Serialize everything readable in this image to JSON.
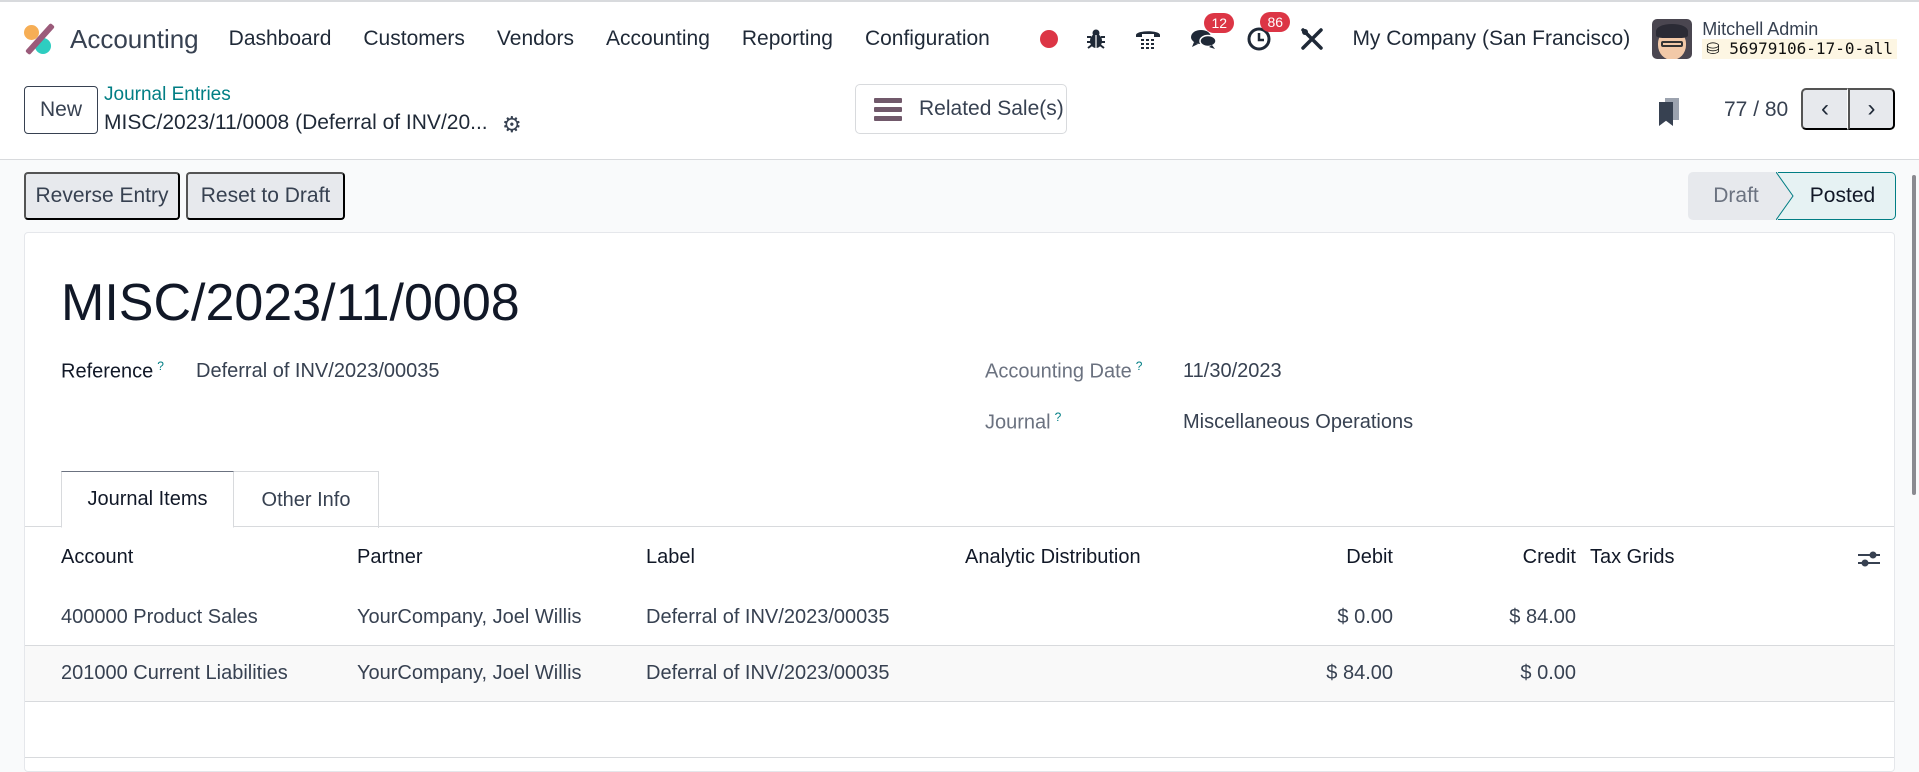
{
  "navbar": {
    "app_name": "Accounting",
    "menu": [
      "Dashboard",
      "Customers",
      "Vendors",
      "Accounting",
      "Reporting",
      "Configuration"
    ],
    "icons": {
      "record": "record-dot-icon",
      "debug": "bug-icon",
      "phone": "phone-icon",
      "messages": "chat-icon",
      "activities": "clock-icon",
      "settings": "tools-icon"
    },
    "messages_count": "12",
    "activities_count": "86",
    "company": "My Company (San Francisco)",
    "user_name": "Mitchell Admin",
    "database": "56979106-17-0-all",
    "colors": {
      "badge": "#dc3545",
      "accent": "#017e84"
    }
  },
  "control_panel": {
    "new_label": "New",
    "breadcrumb_parent": "Journal Entries",
    "breadcrumb_current": "MISC/2023/11/0008 (Deferral of INV/20...",
    "related_button": "Related Sale(s)",
    "pager_value": "77 / 80",
    "prev_symbol": "‹",
    "next_symbol": "›"
  },
  "status_bar": {
    "actions": [
      "Reverse Entry",
      "Reset to Draft"
    ],
    "states": [
      "Draft",
      "Posted"
    ],
    "current_state": "Posted"
  },
  "form": {
    "title": "MISC/2023/11/0008",
    "reference_label": "Reference",
    "reference_value": "Deferral of INV/2023/00035",
    "date_label": "Accounting Date",
    "date_value": "11/30/2023",
    "journal_label": "Journal",
    "journal_value": "Miscellaneous Operations",
    "help_mark": "?",
    "tabs": [
      "Journal Items",
      "Other Info"
    ],
    "active_tab": "Journal Items"
  },
  "table": {
    "columns": [
      "Account",
      "Partner",
      "Label",
      "Analytic Distribution",
      "Debit",
      "Credit",
      "Tax Grids"
    ],
    "rows": [
      {
        "account": "400000 Product Sales",
        "partner": "YourCompany, Joel Willis",
        "label": "Deferral of INV/2023/00035",
        "analytic": "",
        "debit": "$ 0.00",
        "credit": "$ 84.00",
        "tax_grids": ""
      },
      {
        "account": "201000 Current Liabilities",
        "partner": "YourCompany, Joel Willis",
        "label": "Deferral of INV/2023/00035",
        "analytic": "",
        "debit": "$ 84.00",
        "credit": "$ 0.00",
        "tax_grids": ""
      }
    ]
  }
}
